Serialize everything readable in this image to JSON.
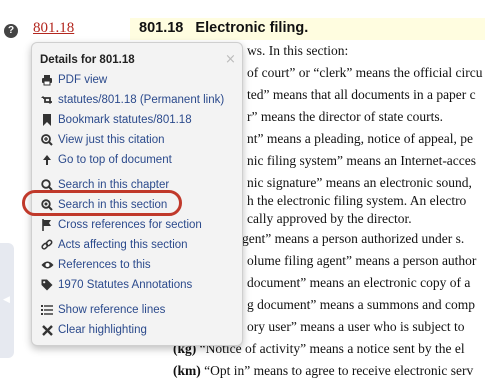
{
  "header": {
    "section_link": "801.18",
    "section_title": "801.18   Electronic filing.",
    "help_icon": "question-icon"
  },
  "body_lines": [
    {
      "num": "",
      "text": "ws. In this section:"
    },
    {
      "num": "",
      "text": "of court” or “clerk” means the official circu"
    },
    {
      "num": "",
      "text": "ted” means that all documents in a paper c"
    },
    {
      "num": "",
      "text": "r” means the director of state courts."
    },
    {
      "num": "",
      "text": "nt” means a pleading, notice of appeal, pe"
    },
    {
      "num": "",
      "text": "nic filing system” means an Internet-acces"
    },
    {
      "num": "",
      "text": "nic signature” means an electronic sound,"
    },
    {
      "num": "",
      "text": "h the electronic filing system. An electro"
    },
    {
      "num": "",
      "text": "cally approved by the director."
    },
    {
      "num": "",
      "text": "gent” means a person authorized under s."
    },
    {
      "num": "",
      "text": "olume filing agent” means a person author"
    },
    {
      "num": "",
      "text": "document” means an electronic copy of a"
    },
    {
      "num": "",
      "text": "g document” means a summons and comp"
    },
    {
      "num": "",
      "text": "ory user” means a user who is subject to"
    },
    {
      "num": "(kg)",
      "text": "“Notice of activity” means a notice sent by the el"
    },
    {
      "num": "(km)",
      "text": "“Opt in” means to agree to receive electronic serv"
    }
  ],
  "popup": {
    "title": "Details for 801.18",
    "close_icon": "close-icon",
    "items": [
      {
        "label": "PDF view",
        "icon": "printer-icon"
      },
      {
        "label": "statutes/801.18 (Permanent link)",
        "icon": "retweet-icon"
      },
      {
        "label": "Bookmark statutes/801.18",
        "icon": "bookmark-icon"
      },
      {
        "label": "View just this citation",
        "icon": "zoom-in-icon"
      },
      {
        "label": "Go to top of document",
        "icon": "arrow-up-icon"
      },
      {
        "label": "Search in this chapter",
        "icon": "search-icon"
      },
      {
        "label": "Search in this section",
        "icon": "search-icon"
      },
      {
        "label": "Cross references for section",
        "icon": "flag-icon"
      },
      {
        "label": "Acts affecting this section",
        "icon": "link-icon"
      },
      {
        "label": "References to this",
        "icon": "eye-icon"
      },
      {
        "label": "1970 Statutes Annotations",
        "icon": "tag-icon"
      },
      {
        "label": "Show reference lines",
        "icon": "list-icon"
      },
      {
        "label": "Clear highlighting",
        "icon": "x-icon"
      }
    ]
  }
}
